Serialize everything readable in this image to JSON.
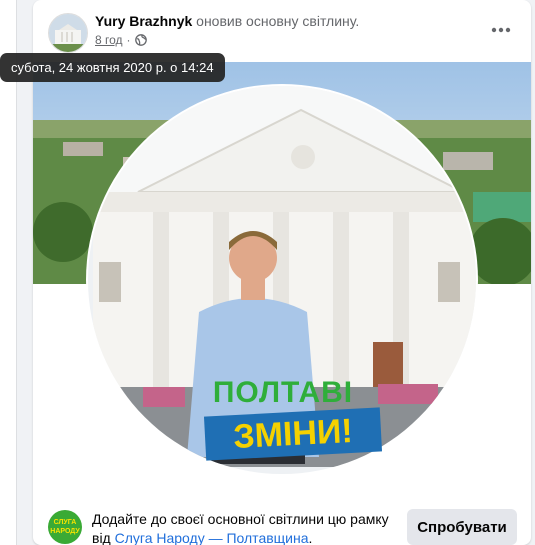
{
  "post": {
    "author_name": "Yury Brazhnyk",
    "action_text": "оновив основну світлину.",
    "time_ago": "8 год",
    "separator": "·",
    "privacy_icon": "globe-icon",
    "more_icon": "ellipsis-icon"
  },
  "tooltip": {
    "text": "субота, 24 жовтня 2020 р. о 14:24"
  },
  "photo": {
    "slogan_line1": "ПОЛТАВІ",
    "slogan_line2": "ЗМІНИ!"
  },
  "frame_prompt": {
    "logo_line1": "СЛУГА",
    "logo_line2": "НАРОДУ",
    "text_before": "Додайте до своєї основної світлини цю рамку від ",
    "link_text": "Слуга Народу — Полтавщина",
    "text_after": ".",
    "button_label": "Спробувати"
  },
  "colors": {
    "link": "#216fdb",
    "party_green": "#3aaa35",
    "party_yellow": "#f7e300",
    "slogan_blue": "#1f6fb4"
  }
}
